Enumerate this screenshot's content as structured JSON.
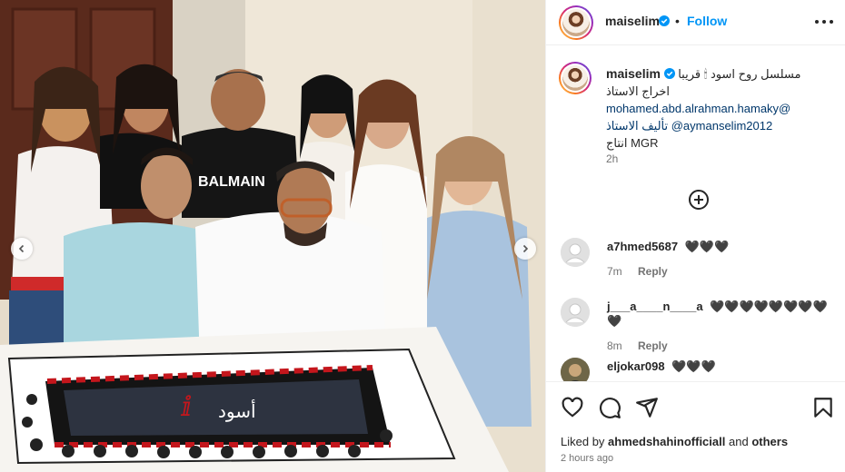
{
  "post": {
    "username": "maiselim",
    "follow_label": "Follow",
    "separator": "•",
    "caption_lines": [
      "مسلسل روح اسود 🕯 قريبا",
      "اخراج الاستاذ",
      "mohamed.abd.alrahman.hamaky@",
      "تأليف الاستاذ @aymanselim2012",
      "انتاج MGR"
    ],
    "caption_time": "2h"
  },
  "comments": [
    {
      "user": "a7hmed5687",
      "text": "🖤🖤🖤",
      "time": "7m",
      "reply": "Reply"
    },
    {
      "user": "j___a____n____a",
      "text": "🖤🖤🖤🖤🖤🖤🖤🖤🖤",
      "time": "8m",
      "reply": "Reply"
    },
    {
      "user": "eljokar098",
      "text": "🖤🖤🖤",
      "time": "",
      "reply": ""
    }
  ],
  "footer": {
    "liked_by_prefix": "Liked by",
    "liked_by_user": "ahmedshahinofficiall",
    "liked_by_and": "and",
    "liked_by_others": "others",
    "posted_ago": "2 hours ago"
  },
  "colors": {
    "accent": "#0095f6",
    "text": "#262626",
    "muted": "#737373",
    "link": "#00376b"
  },
  "icons": [
    "verified-badge-icon",
    "more-options-icon",
    "add-comment-icon",
    "heart-icon",
    "comment-icon",
    "share-icon",
    "save-icon",
    "chevron-left-icon",
    "chevron-right-icon"
  ]
}
